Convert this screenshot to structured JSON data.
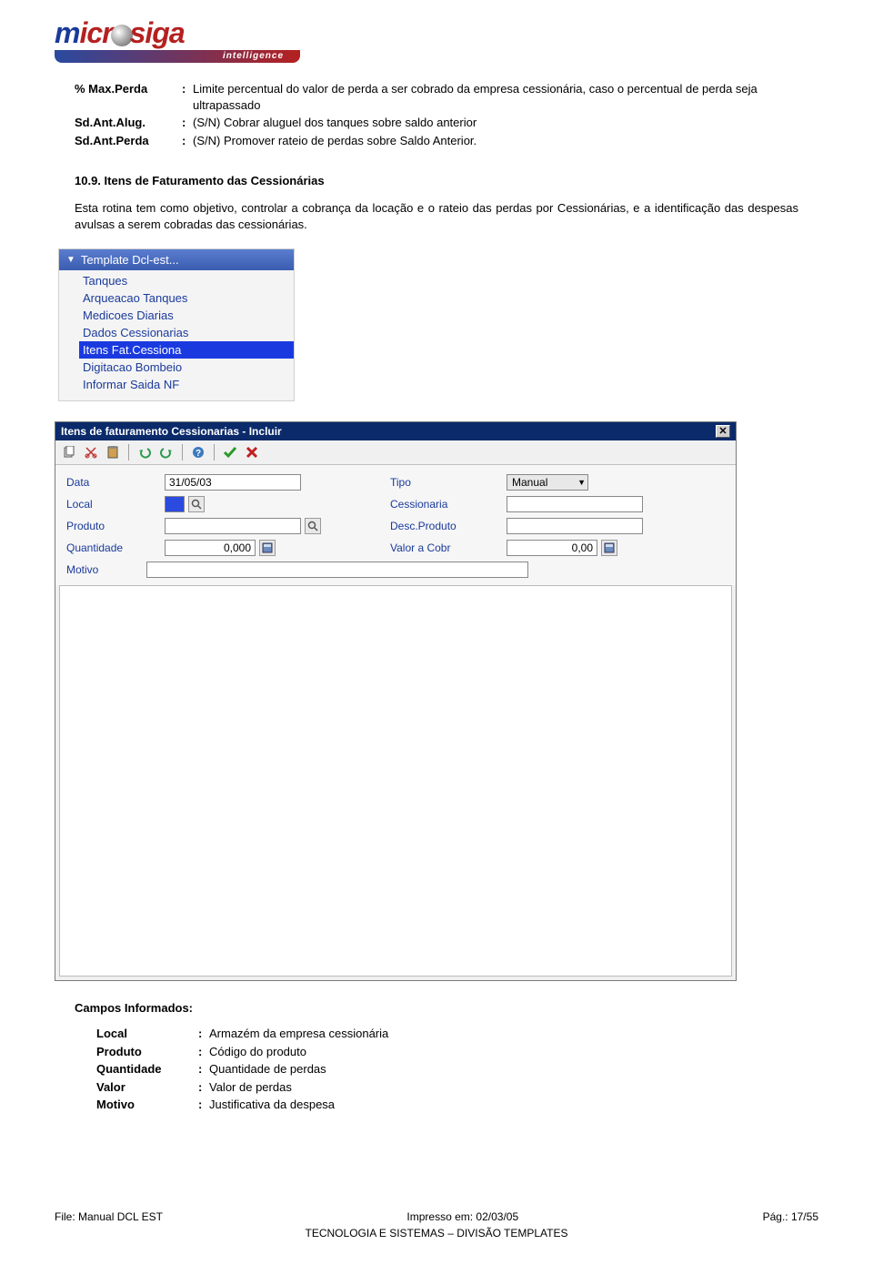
{
  "logo": {
    "sub": "intelligence"
  },
  "definitions": [
    {
      "label": "% Max.Perda",
      "text": "Limite percentual do valor de perda a ser cobrado da empresa cessionária, caso o percentual de perda seja ultrapassado"
    },
    {
      "label": "Sd.Ant.Alug.",
      "text": "(S/N) Cobrar aluguel dos tanques sobre saldo anterior"
    },
    {
      "label": "Sd.Ant.Perda",
      "text": "(S/N) Promover rateio de perdas sobre Saldo Anterior."
    }
  ],
  "section": {
    "number": "10.9.",
    "title": "Itens de Faturamento das Cessionárias",
    "paragraph": "Esta rotina tem como objetivo, controlar a cobrança da locação e o rateio das perdas por Cessionárias, e a  identificação das despesas avulsas a serem cobradas das cessionárias."
  },
  "menu": {
    "header": "Template Dcl-est...",
    "items": [
      {
        "label": "Tanques",
        "selected": false
      },
      {
        "label": "Arqueacao Tanques",
        "selected": false
      },
      {
        "label": "Medicoes Diarias",
        "selected": false
      },
      {
        "label": "Dados Cessionarias",
        "selected": false
      },
      {
        "label": "Itens Fat.Cessiona",
        "selected": true
      },
      {
        "label": "Digitacao Bombeio",
        "selected": false
      },
      {
        "label": "Informar Saida NF",
        "selected": false
      }
    ]
  },
  "dialog": {
    "title": "Itens de faturamento Cessionarias - Incluir",
    "toolbar_icons": [
      "copy-icon",
      "cut-icon",
      "paste-icon",
      "undo-icon",
      "redo-icon",
      "help-icon",
      "ok-icon",
      "cancel-icon"
    ],
    "fields": {
      "data_label": "Data",
      "data_value": "31/05/03",
      "tipo_label": "Tipo",
      "tipo_value": "Manual",
      "local_label": "Local",
      "local_value": "",
      "cessionaria_label": "Cessionaria",
      "cessionaria_value": "",
      "produto_label": "Produto",
      "produto_value": "",
      "descproduto_label": "Desc.Produto",
      "descproduto_value": "",
      "quantidade_label": "Quantidade",
      "quantidade_value": "0,000",
      "valorcobr_label": "Valor a Cobr",
      "valorcobr_value": "0,00",
      "motivo_label": "Motivo",
      "motivo_value": ""
    }
  },
  "campos": {
    "heading": "Campos Informados:",
    "rows": [
      {
        "label": "Local",
        "text": "Armazém da empresa cessionária"
      },
      {
        "label": "Produto",
        "text": "Código do produto"
      },
      {
        "label": "Quantidade",
        "text": "Quantidade de perdas"
      },
      {
        "label": "Valor",
        "text": "Valor de perdas"
      },
      {
        "label": "Motivo",
        "text": "Justificativa da despesa"
      }
    ]
  },
  "footer": {
    "file": "File: Manual DCL EST",
    "printed": "Impresso em: 02/03/05",
    "page": "Pág.: 17/55",
    "org": "TECNOLOGIA E SISTEMAS – DIVISÃO TEMPLATES"
  }
}
